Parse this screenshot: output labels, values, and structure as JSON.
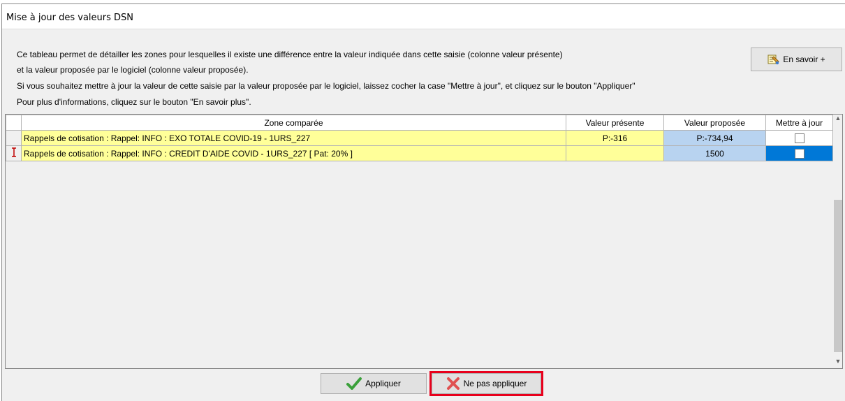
{
  "window": {
    "title": "Mise à jour des valeurs DSN"
  },
  "description": {
    "line1": "Ce tableau permet de détailler les zones pour lesquelles il existe une différence entre la valeur indiquée dans cette saisie (colonne valeur présente)",
    "line2": "et la valeur proposée par le logiciel (colonne valeur proposée).",
    "line3": "Si vous souhaitez mettre à jour la valeur de cette saisie par la valeur proposée par le logiciel, laissez cocher la case \"Mettre à jour\", et cliquez sur le bouton \"Appliquer\"",
    "line4": "Pour plus d'informations, cliquez sur le bouton \"En savoir plus\"."
  },
  "info_button": {
    "label": "En savoir +",
    "icon": "notes-icon"
  },
  "table": {
    "headers": [
      "Zone comparée",
      "Valeur présente",
      "Valeur proposée",
      "Mettre à jour"
    ],
    "rows": [
      {
        "zone": "Rappels de cotisation : Rappel: INFO : EXO TOTALE COVID-19 - 1URS_227",
        "present": "P:-316",
        "proposed": "P:-734,94",
        "update": false,
        "current": false
      },
      {
        "zone": "Rappels de cotisation : Rappel: INFO : CREDIT D'AIDE COVID - 1URS_227 [ Pat: 20% ]",
        "present": "",
        "proposed": "1500",
        "update": false,
        "current": true
      }
    ]
  },
  "buttons": {
    "apply": "Appliquer",
    "cancel": "Ne pas appliquer"
  },
  "colors": {
    "zone_bg": "#ffff99",
    "proposed_bg": "#b8d3f0",
    "selected_bg": "#0078d7",
    "highlight": "#e8001c"
  }
}
